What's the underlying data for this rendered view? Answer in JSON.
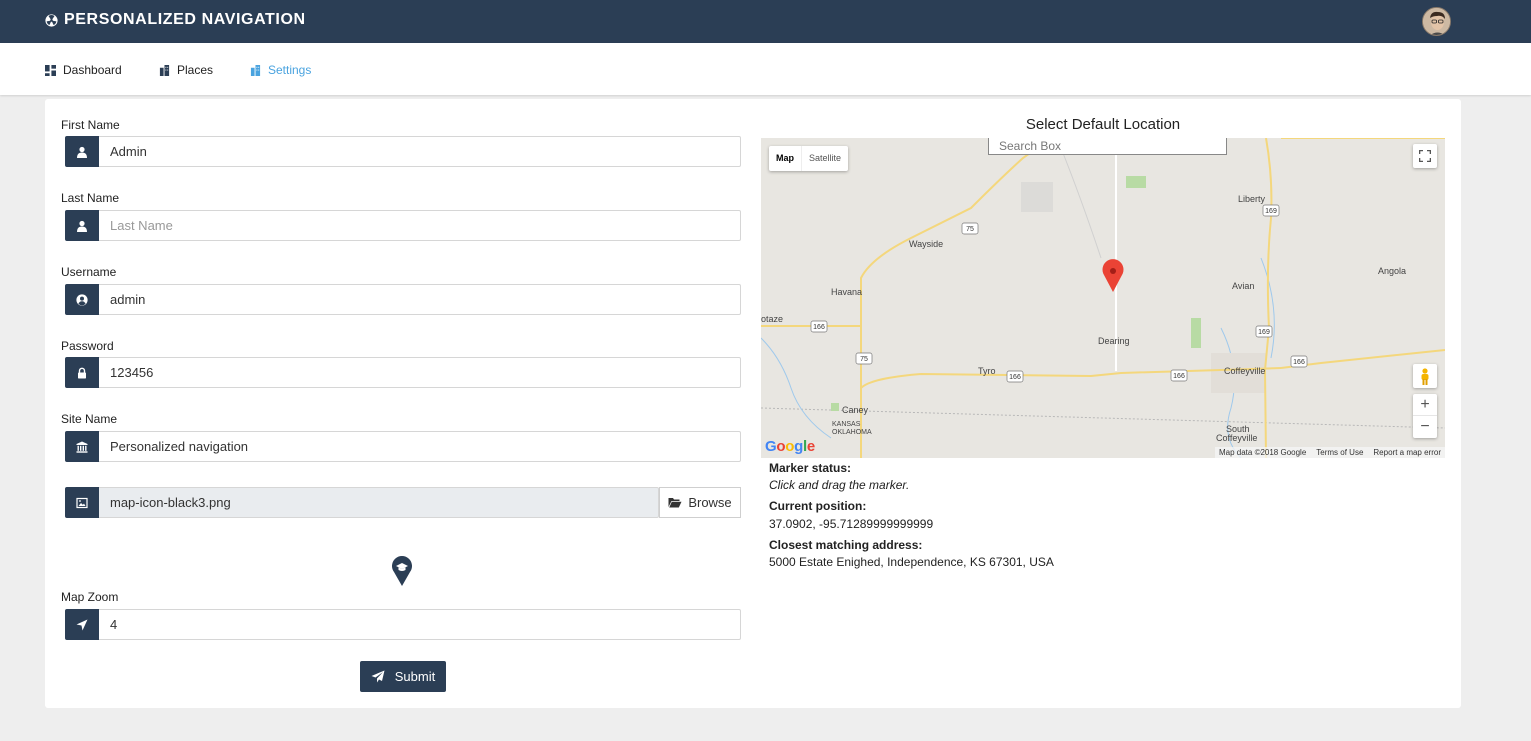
{
  "app": {
    "title": "PERSONALIZED NAVIGATION"
  },
  "nav": {
    "items": [
      {
        "label": "Dashboard"
      },
      {
        "label": "Places"
      },
      {
        "label": "Settings"
      }
    ]
  },
  "form": {
    "first_name": {
      "label": "First Name",
      "value": "Admin"
    },
    "last_name": {
      "label": "Last Name",
      "value": "",
      "placeholder": "Last Name"
    },
    "username": {
      "label": "Username",
      "value": "admin"
    },
    "password": {
      "label": "Password",
      "value": "123456"
    },
    "site_name": {
      "label": "Site Name",
      "value": "Personalized navigation"
    },
    "map_icon": {
      "value": "map-icon-black3.png",
      "browse_label": "Browse"
    },
    "map_zoom": {
      "label": "Map Zoom",
      "value": "4"
    },
    "submit_label": "Submit"
  },
  "map": {
    "title": "Select Default Location",
    "search_placeholder": "Search Box",
    "map_type_map": "Map",
    "map_type_satellite": "Satellite",
    "logo": "Google",
    "attribution": {
      "data": "Map data ©2018 Google",
      "terms": "Terms of Use",
      "report": "Report a map error"
    },
    "places": [
      "Wayside",
      "Havana",
      "Liberty",
      "Avian",
      "Angola",
      "Dearing",
      "Tyro",
      "Coffeyville",
      "Caney",
      "KANSAS",
      "OKLAHOMA",
      "South",
      "Coffeyville",
      "otaze"
    ],
    "routes": [
      "75",
      "166",
      "75",
      "166",
      "166",
      "169",
      "169",
      "166"
    ]
  },
  "status": {
    "marker_label": "Marker status:",
    "marker_value": "Click and drag the marker.",
    "position_label": "Current position:",
    "position_value": "37.0902, -95.71289999999999",
    "address_label": "Closest matching address:",
    "address_value": "5000 Estate Enighed, Independence, KS 67301, USA"
  },
  "colors": {
    "header_bg": "#2b3e55",
    "accent": "#4aa3df",
    "page_bg": "#eeeeee"
  }
}
